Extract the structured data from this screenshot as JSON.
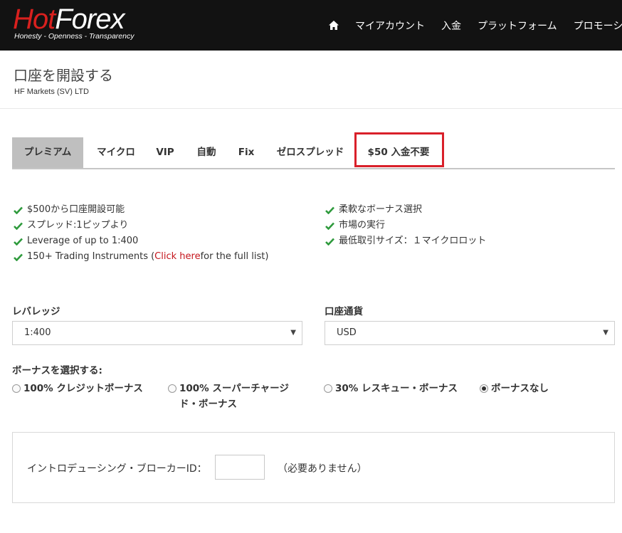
{
  "header": {
    "logo_hot": "Hot",
    "logo_forex": "Forex",
    "logo_tagline": "Honesty - Openness - Transparency",
    "nav": [
      "マイアカウント",
      "入金",
      "プラットフォーム",
      "プロモーション"
    ]
  },
  "page": {
    "title": "口座を開設する",
    "subtitle": "HF Markets (SV) LTD"
  },
  "tabs": [
    "プレミアム",
    "マイクロ",
    "VIP",
    "自動",
    "Fix",
    "ゼロスプレッド",
    "$50 入金不要"
  ],
  "features": {
    "left": [
      "$500から口座開設可能",
      "スプレッド:1ピップより",
      "Leverage of up to 1:400"
    ],
    "left_last_prefix": "150+ Trading Instruments (",
    "left_last_link": "Click here",
    "left_last_suffix": " for the full list)",
    "right": [
      "柔軟なボーナス選択",
      "市場の実行",
      "最低取引サイズ：１マイクロロット"
    ]
  },
  "form": {
    "leverage_label": "レバレッジ",
    "leverage_value": "1:400",
    "currency_label": "口座通貨",
    "currency_value": "USD",
    "bonus_label": "ボーナスを選択する:",
    "bonus_options": [
      {
        "line1": "100% クレジットボーナス",
        "line2": ""
      },
      {
        "line1": "100% スーパーチャージ",
        "line2": "ド・ボーナス"
      },
      {
        "line1": "30% レスキュー・ボーナス",
        "line2": ""
      },
      {
        "line1": "ボーナスなし",
        "line2": ""
      }
    ],
    "selected_bonus": "ボーナスなし",
    "ib_label": "イントロデューシング・ブローカーID：",
    "ib_value": "",
    "ib_note": "（必要ありません）"
  },
  "colors": {
    "header_bg": "#121212",
    "brand_red": "#d8201e",
    "check_green": "#2e9a3c",
    "active_tab": "#bfbfbf",
    "highlight_red": "#d9202a"
  }
}
